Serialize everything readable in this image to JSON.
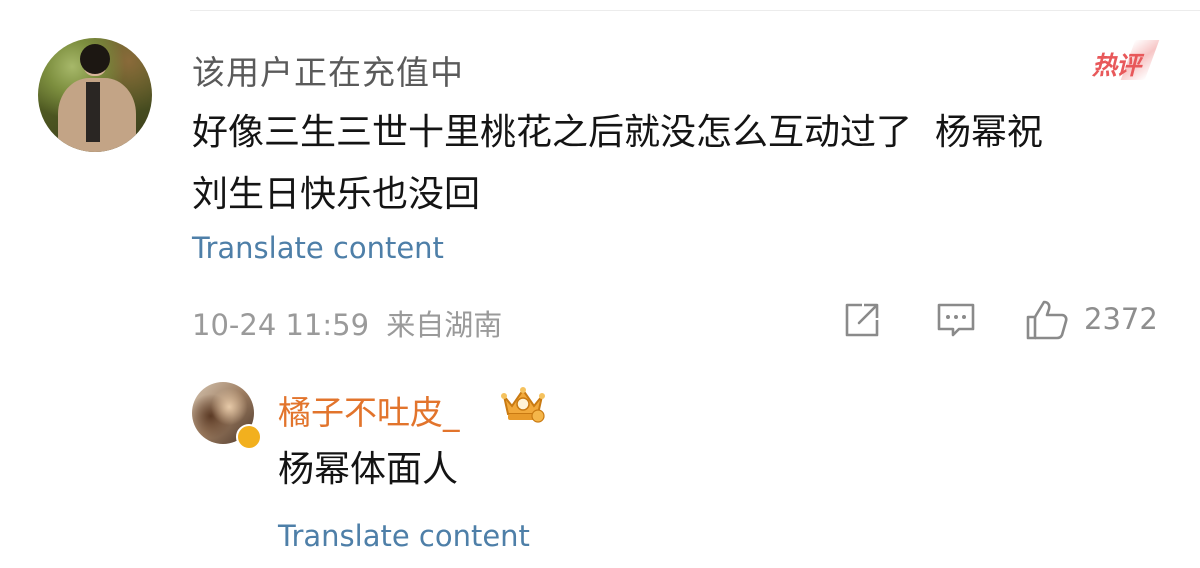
{
  "comment": {
    "username": "该用户正在充值中",
    "hot_label": "热评",
    "text": "好像三生三世十里桃花之后就没怎么互动过了  杨幂祝\n刘生日快乐也没回",
    "translate": "Translate content",
    "date": "10-24 11:59",
    "location": "来自湖南",
    "likes": "2372",
    "share_icon": "share-icon",
    "comment_icon": "comment-icon",
    "like_icon": "thumbs-up-icon"
  },
  "reply": {
    "username": "橘子不吐皮_",
    "text": "杨幂体面人",
    "translate": "Translate content",
    "badge_icon": "crown-badge-icon",
    "verified_icon": "verified-badge-icon"
  },
  "colors": {
    "username_gray": "#5a5a5a",
    "link_blue": "#4e7fa8",
    "reply_name_orange": "#e2742c",
    "hot_red": "#e8585a",
    "meta_gray": "#9a9a9a"
  }
}
